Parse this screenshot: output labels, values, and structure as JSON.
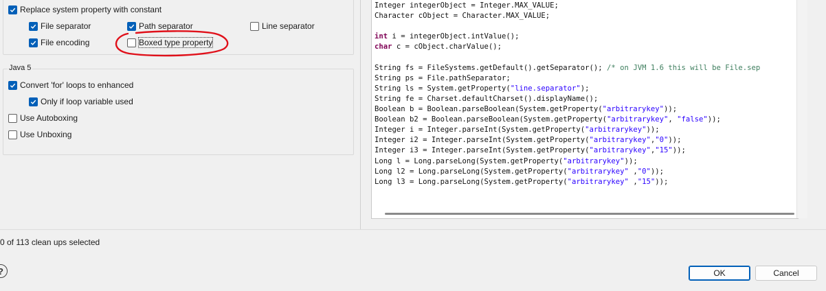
{
  "options_top": {
    "replace_system_property": {
      "label": "Replace system property with constant",
      "checked": true
    },
    "file_separator": {
      "label": "File separator",
      "checked": true
    },
    "path_separator": {
      "label": "Path separator",
      "checked": true
    },
    "line_separator": {
      "label": "Line separator",
      "checked": false
    },
    "file_encoding": {
      "label": "File encoding",
      "checked": true
    },
    "boxed_type_property": {
      "label": "Boxed type property",
      "checked": false
    }
  },
  "java5": {
    "title": "Java 5",
    "convert_for_loops": {
      "label": "Convert 'for' loops to enhanced",
      "checked": true
    },
    "only_if_loop_var_used": {
      "label": "Only if loop variable used",
      "checked": true
    },
    "use_autoboxing": {
      "label": "Use Autoboxing",
      "checked": false
    },
    "use_unboxing": {
      "label": "Use Unboxing",
      "checked": false
    }
  },
  "preview": {
    "lines": [
      "Integer integerObject = Integer.MAX_VALUE;",
      "Character cObject = Character.MAX_VALUE;",
      "",
      "int i = integerObject.intValue();",
      "char c = cObject.charValue();",
      "",
      "String fs = FileSystems.getDefault().getSeparator(); /* on JVM 1.6 this will be File.sep",
      "String ps = File.pathSeparator;",
      "String ls = System.getProperty(\"line.separator\");",
      "String fe = Charset.defaultCharset().displayName();",
      "Boolean b = Boolean.parseBoolean(System.getProperty(\"arbitrarykey\"));",
      "Boolean b2 = Boolean.parseBoolean(System.getProperty(\"arbitrarykey\", \"false\"));",
      "Integer i = Integer.parseInt(System.getProperty(\"arbitrarykey\"));",
      "Integer i2 = Integer.parseInt(System.getProperty(\"arbitrarykey\",\"0\"));",
      "Integer i3 = Integer.parseInt(System.getProperty(\"arbitrarykey\",\"15\"));",
      "Long l = Long.parseLong(System.getProperty(\"arbitrarykey\"));",
      "Long l2 = Long.parseLong(System.getProperty(\"arbitrarykey\" ,\"0\"));",
      "Long l3 = Long.parseLong(System.getProperty(\"arbitrarykey\" ,\"15\"));"
    ]
  },
  "status": {
    "text": "0 of 113 clean ups selected"
  },
  "buttons": {
    "help": "?",
    "ok": "OK",
    "cancel": "Cancel"
  },
  "colors": {
    "accent": "#005fb8",
    "annotation": "#e0101a",
    "keyword": "#7f0055",
    "string": "#2a00ff",
    "comment": "#3f7f5f"
  },
  "icons": {
    "checkbox_check": "check-icon",
    "help": "help-icon"
  }
}
